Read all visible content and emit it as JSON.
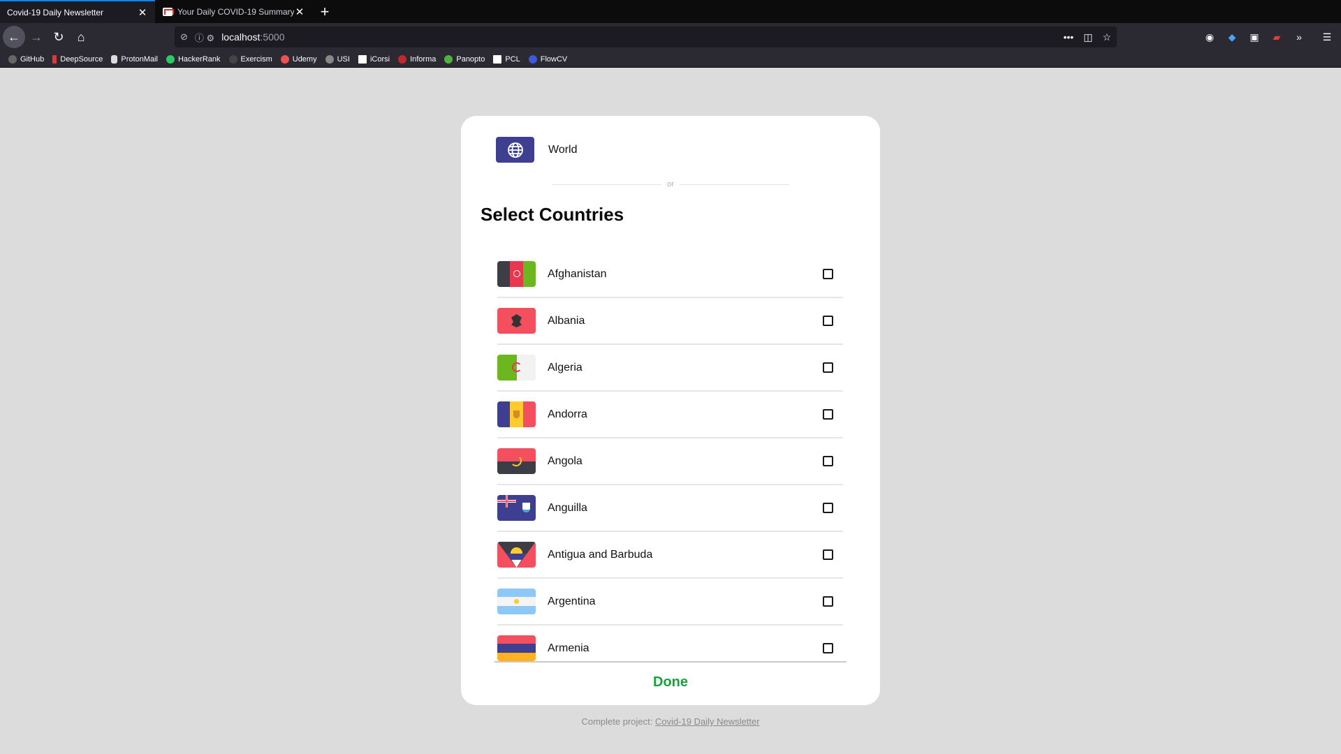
{
  "browser": {
    "tabs": [
      {
        "title": "Covid-19 Daily Newsletter",
        "active": true
      },
      {
        "title": "Your Daily COVID-19 Summary",
        "active": false
      }
    ],
    "url": {
      "host": "localhost",
      "port": ":5000"
    },
    "bookmarks": [
      "GitHub",
      "DeepSource",
      "ProtonMail",
      "HackerRank",
      "Exercism",
      "Udemy",
      "USI",
      "iCorsi",
      "Informa",
      "Panopto",
      "PCL",
      "FlowCV"
    ]
  },
  "selector": {
    "world_label": "World",
    "or_text": "or",
    "title": "Select Countries",
    "countries": [
      {
        "name": "Afghanistan",
        "checked": false
      },
      {
        "name": "Albania",
        "checked": false
      },
      {
        "name": "Algeria",
        "checked": false
      },
      {
        "name": "Andorra",
        "checked": false
      },
      {
        "name": "Angola",
        "checked": false
      },
      {
        "name": "Anguilla",
        "checked": false
      },
      {
        "name": "Antigua and Barbuda",
        "checked": false
      },
      {
        "name": "Argentina",
        "checked": false
      },
      {
        "name": "Armenia",
        "checked": false
      }
    ],
    "done_label": "Done"
  },
  "footer": {
    "prefix": "Complete project: ",
    "link": "Covid-19 Daily Newsletter"
  },
  "colors": {
    "accent_done": "#17a23a",
    "world_flag": "#3f3f92"
  }
}
